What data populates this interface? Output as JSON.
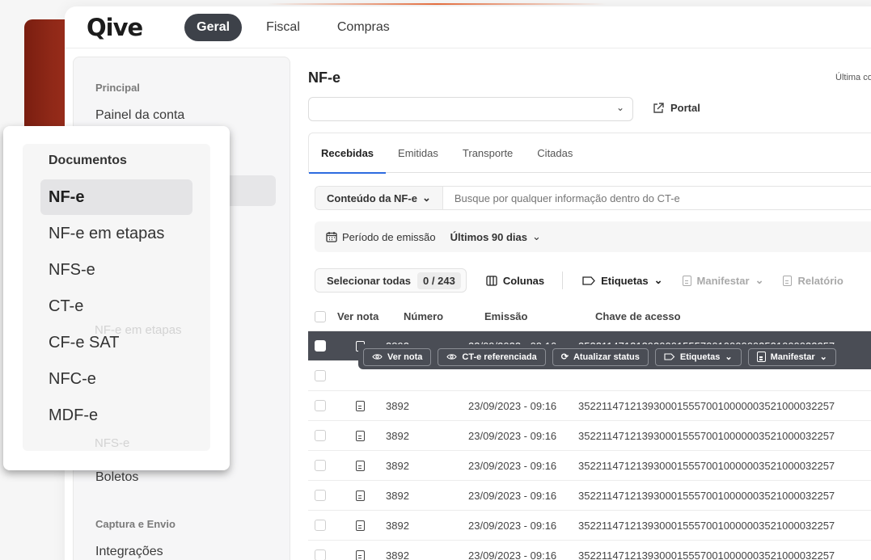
{
  "app": {
    "logo": "Qive"
  },
  "nav": {
    "items": [
      {
        "label": "Geral",
        "active": true
      },
      {
        "label": "Fiscal"
      },
      {
        "label": "Compras"
      }
    ]
  },
  "sidebar": {
    "section_principal": "Principal",
    "painel": "Painel da conta",
    "boletos": "Boletos",
    "section_captura": "Captura e Envio",
    "integracoes": "Integrações"
  },
  "page": {
    "title": "NF-e",
    "ultima": "Última co",
    "portal_label": "Portal",
    "tabs": [
      {
        "label": "Recebidas",
        "active": true
      },
      {
        "label": "Emitidas"
      },
      {
        "label": "Transporte"
      },
      {
        "label": "Citadas"
      }
    ],
    "search_scope": "Conteúdo da NF-e",
    "search_placeholder": "Busque por qualquer informação dentro do CT-e",
    "periodo_label": "Período de emissão",
    "periodo_value": "Últimos 90 dias",
    "toolbar": {
      "select_all": "Selecionar todas",
      "count": "0 / 243",
      "colunas": "Colunas",
      "etiquetas": "Etiquetas",
      "manifestar": "Manifestar",
      "relatorio": "Relatório"
    },
    "table": {
      "headers": {
        "ver_nota": "Ver nota",
        "numero": "Número",
        "emissao": "Emissão",
        "chave": "Chave de acesso"
      },
      "rows": [
        {
          "numero": "3892",
          "emissao": "23/09/2023 - 09:16",
          "chave": "35221147121393000155570010000003521000032257"
        },
        {
          "numero": "3892",
          "emissao": "23/09/2023 - 09:16",
          "chave": "35221147121393000155570010000003521000032257"
        },
        {
          "numero": "3892",
          "emissao": "23/09/2023 - 09:16",
          "chave": "35221147121393000155570010000003521000032257"
        },
        {
          "numero": "3892",
          "emissao": "23/09/2023 - 09:16",
          "chave": "35221147121393000155570010000003521000032257"
        },
        {
          "numero": "3892",
          "emissao": "23/09/2023 - 09:16",
          "chave": "35221147121393000155570010000003521000032257"
        },
        {
          "numero": "3892",
          "emissao": "23/09/2023 - 09:16",
          "chave": "35221147121393000155570010000003521000032257"
        },
        {
          "numero": "3892",
          "emissao": "23/09/2023 - 09:16",
          "chave": "35221147121393000155570010000003521000032257"
        }
      ],
      "row_actions": {
        "ver_nota": "Ver nota",
        "cte_ref": "CT-e referenciada",
        "atualizar": "Atualizar status",
        "etiquetas": "Etiquetas",
        "manifestar": "Manifestar"
      }
    }
  },
  "overlay": {
    "section": "Documentos",
    "items": [
      {
        "label": "NF-e",
        "active": true
      },
      {
        "label": "NF-e em etapas"
      },
      {
        "label": "NFS-e"
      },
      {
        "label": "CT-e"
      },
      {
        "label": "CF-e SAT"
      },
      {
        "label": "NFC-e"
      },
      {
        "label": "MDF-e"
      }
    ]
  },
  "colors": {
    "accent": "#c8361b",
    "nav_active_bg": "#3d4149",
    "selected_row": "#4a4d55",
    "tab_underline": "#2d6be0"
  }
}
